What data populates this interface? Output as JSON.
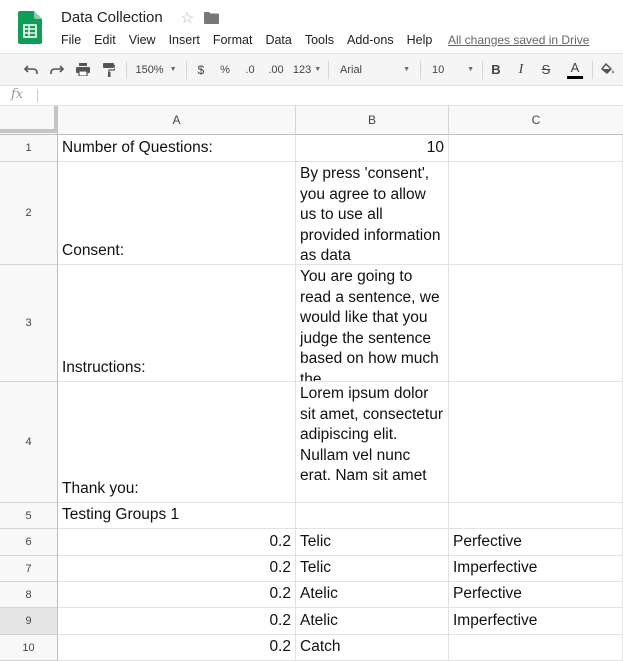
{
  "app": {
    "title": "Data Collection",
    "menu": [
      "File",
      "Edit",
      "View",
      "Insert",
      "Format",
      "Data",
      "Tools",
      "Add-ons",
      "Help"
    ],
    "saved_status": "All changes saved in Drive",
    "brand_color": "#0f9d58"
  },
  "toolbar": {
    "zoom": "150%",
    "currency": "$",
    "percent": "%",
    "decrease_decimal": ".0",
    "increase_decimal": ".00",
    "more_formats": "123",
    "font": "Arial",
    "font_size": "10",
    "bold": "B",
    "italic": "I",
    "strikethrough": "S",
    "text_color": "A",
    "icons": [
      "undo-icon",
      "redo-icon",
      "print-icon",
      "paint-format-icon",
      "fill-color-icon"
    ]
  },
  "formula_bar": {
    "label": "fx",
    "value": ""
  },
  "sheet": {
    "columns": [
      "A",
      "B",
      "C"
    ],
    "rows": [
      {
        "num": "1",
        "a": "Number of Questions:",
        "b": "10",
        "c": ""
      },
      {
        "num": "2",
        "a": "Consent:",
        "b": "By press 'consent', you agree to allow us to use all provided information as data",
        "c": ""
      },
      {
        "num": "3",
        "a": "Instructions:",
        "b": "You are going to read a sentence, we would like that you judge the sentence based on how much the",
        "c": ""
      },
      {
        "num": "4",
        "a": "Thank you:",
        "b": "Lorem ipsum dolor sit amet, consectetur adipiscing elit. Nullam vel nunc erat. Nam sit amet",
        "c": ""
      },
      {
        "num": "5",
        "a": "Testing Groups 1",
        "b": "",
        "c": ""
      },
      {
        "num": "6",
        "a": "0.2",
        "b": "Telic",
        "c": "Perfective"
      },
      {
        "num": "7",
        "a": "0.2",
        "b": "Telic",
        "c": "Imperfective"
      },
      {
        "num": "8",
        "a": "0.2",
        "b": "Atelic",
        "c": "Perfective"
      },
      {
        "num": "9",
        "a": "0.2",
        "b": "Atelic",
        "c": "Imperfective"
      },
      {
        "num": "10",
        "a": "0.2",
        "b": "Catch",
        "c": ""
      }
    ],
    "selected_row": "9"
  }
}
